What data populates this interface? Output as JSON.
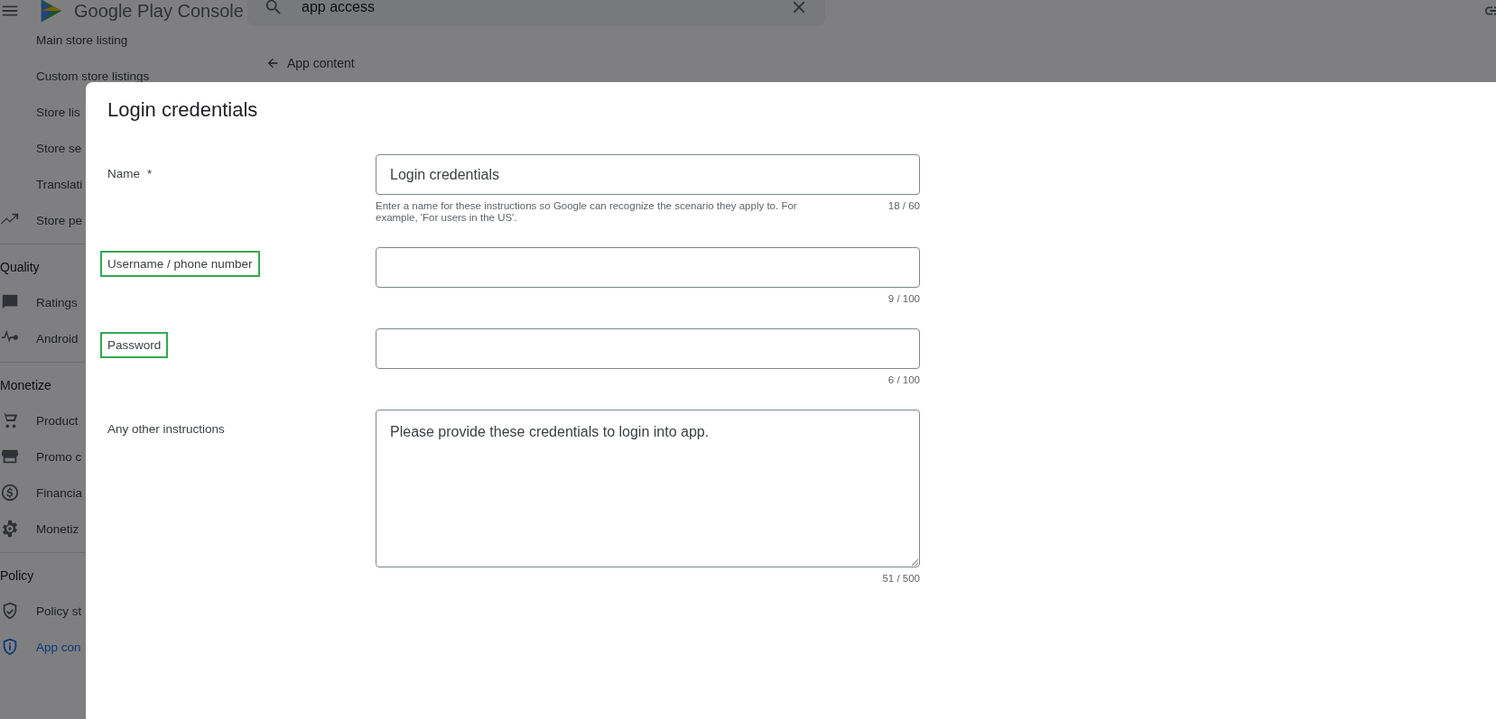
{
  "topbar": {
    "product_name": "Google Play Console",
    "search": {
      "value": "app access"
    }
  },
  "breadcrumb": {
    "label": "App content"
  },
  "sidebar": {
    "sections": [
      {
        "items": [
          {
            "label": "Main store listing",
            "selected": false
          },
          {
            "label": "Custom store listings",
            "selected": false
          },
          {
            "label": "Store lis",
            "selected": false
          },
          {
            "label": "Store se",
            "selected": false
          },
          {
            "label": "Translati",
            "selected": false
          },
          {
            "label": "Store pe",
            "selected": false
          }
        ]
      },
      {
        "title": "Quality",
        "items": [
          {
            "label": "Ratings",
            "selected": false
          },
          {
            "label": "Android",
            "selected": false
          }
        ]
      },
      {
        "title": "Monetize",
        "items": [
          {
            "label": "Product",
            "selected": false
          },
          {
            "label": "Promo c",
            "selected": false
          },
          {
            "label": "Financia",
            "selected": false
          },
          {
            "label": "Monetiz",
            "selected": false
          }
        ]
      },
      {
        "title": "Policy",
        "items": [
          {
            "label": "Policy st",
            "selected": false
          },
          {
            "label": "App con",
            "selected": true
          }
        ]
      }
    ]
  },
  "dialog": {
    "title": "Login credentials",
    "fields": [
      {
        "kind": "input",
        "label": "Name",
        "required_mark": "*",
        "highlighted": false,
        "value": "Login credentials",
        "helper": "Enter a name for these instructions so Google can recognize the scenario they apply to. For example, 'For users in the US'.",
        "counter": "18 / 60"
      },
      {
        "kind": "input",
        "label": "Username / phone number",
        "highlighted": true,
        "counter": "9 / 100"
      },
      {
        "kind": "password",
        "label": "Password",
        "highlighted": true,
        "counter": "6 / 100"
      },
      {
        "kind": "textarea",
        "label": "Any other instructions",
        "highlighted": false,
        "value": "Please provide these credentials to login into app.",
        "counter": "51 / 500"
      }
    ]
  }
}
